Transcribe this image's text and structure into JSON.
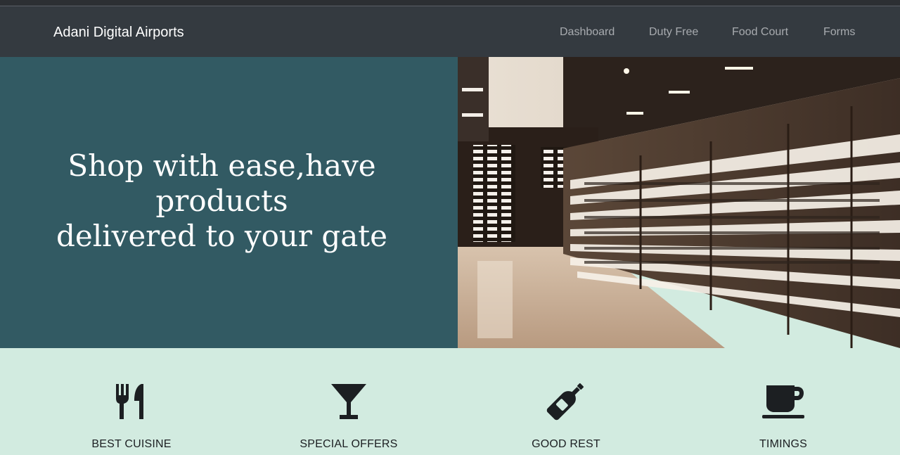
{
  "navbar": {
    "brand": "Adani Digital Airports",
    "links": [
      {
        "label": "Dashboard"
      },
      {
        "label": "Duty Free"
      },
      {
        "label": "Food Court"
      },
      {
        "label": "Forms"
      }
    ]
  },
  "hero": {
    "line1": "Shop with ease,have products",
    "line2": "delivered to your gate",
    "image_alt": "duty free sunglasses store shelves"
  },
  "features": [
    {
      "label": "BEST CUISINE",
      "icon": "utensils-icon"
    },
    {
      "label": "SPECIAL OFFERS",
      "icon": "cocktail-glass-icon"
    },
    {
      "label": "GOOD REST",
      "icon": "wine-bottle-icon"
    },
    {
      "label": "TIMINGS",
      "icon": "coffee-cup-icon"
    }
  ],
  "colors": {
    "navbar_bg": "#343a40",
    "hero_bg": "#325a63",
    "feature_bg": "#d2ebe0",
    "icon": "#1c1f22"
  }
}
